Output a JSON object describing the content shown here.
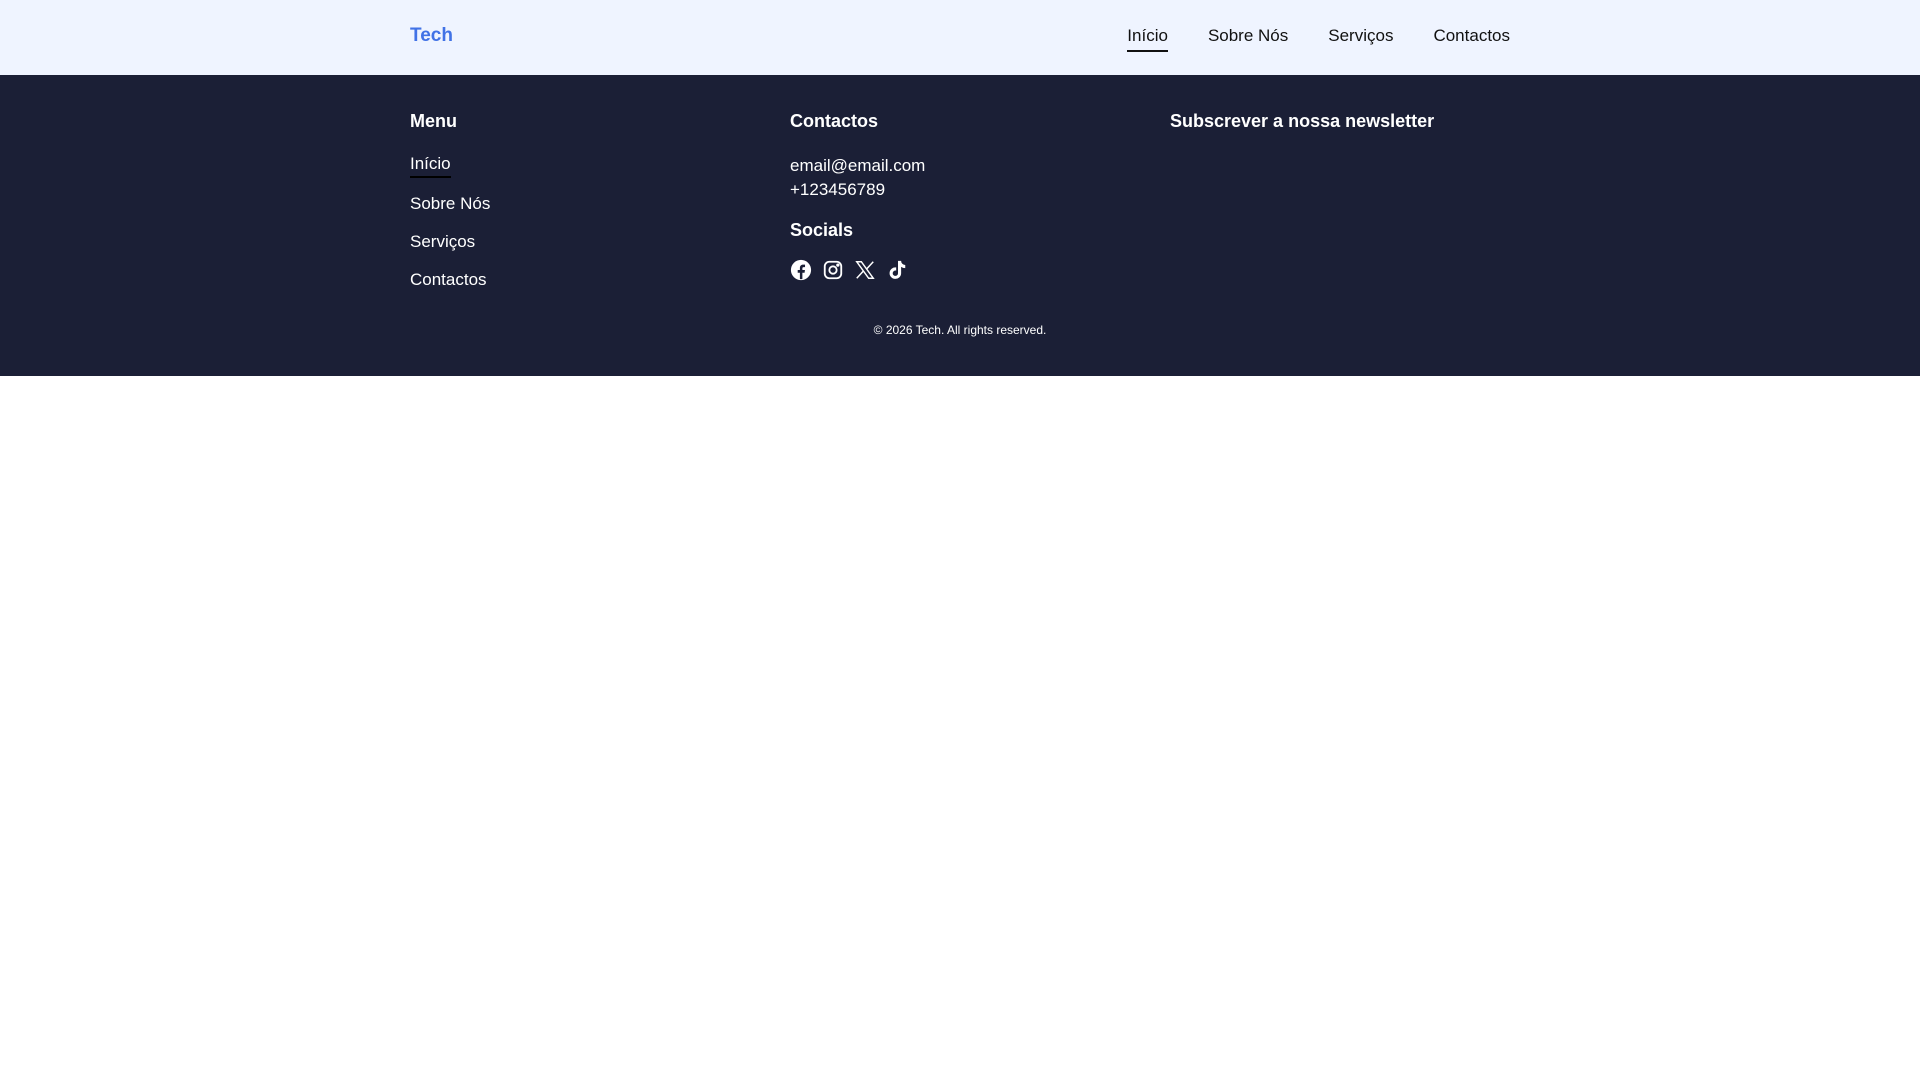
{
  "header": {
    "logo": "Tech",
    "nav": [
      {
        "label": "Início"
      },
      {
        "label": "Sobre Nós"
      },
      {
        "label": "Serviços"
      },
      {
        "label": "Contactos"
      }
    ]
  },
  "footer": {
    "menu": {
      "title": "Menu",
      "items": [
        {
          "label": "Início"
        },
        {
          "label": "Sobre Nós"
        },
        {
          "label": "Serviços"
        },
        {
          "label": "Contactos"
        }
      ]
    },
    "contacts": {
      "title": "Contactos",
      "email": "email@email.com",
      "phone": "+123456789"
    },
    "socials": {
      "title": "Socials",
      "icons": [
        "facebook-icon",
        "instagram-icon",
        "x-icon",
        "tiktok-icon"
      ]
    },
    "newsletter": {
      "title": "Subscrever a nossa newsletter"
    },
    "copyright": "© 2026 Tech. All rights reserved."
  },
  "colors": {
    "header_bg": "#eff4ff",
    "footer_bg": "#1b1f36",
    "brand": "#4172e6"
  }
}
